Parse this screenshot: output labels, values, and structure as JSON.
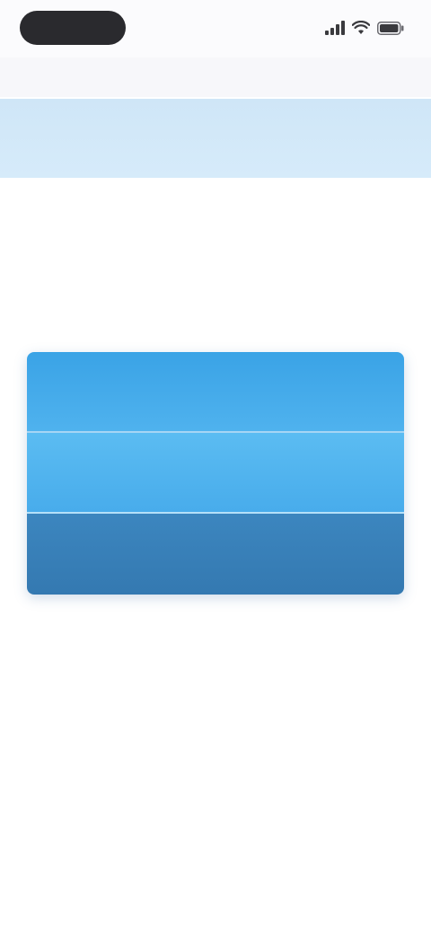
{
  "status_bar": {
    "time": "",
    "battery_icon": "battery-icon",
    "wifi_icon": "wifi-icon",
    "signal_icon": "signal-icon"
  },
  "url_bar": {
    "url": ""
  },
  "header": {
    "brand": ""
  },
  "content": {
    "intro": "",
    "prompt": ""
  },
  "options": [
    {
      "label": ""
    },
    {
      "label": ""
    },
    {
      "label": ""
    }
  ],
  "colors": {
    "header_bg": "#d2e8f8",
    "brand": "#7fa86a",
    "option_1": "#42a8e9",
    "option_2": "#52b4ef",
    "option_3": "#3880b8"
  }
}
